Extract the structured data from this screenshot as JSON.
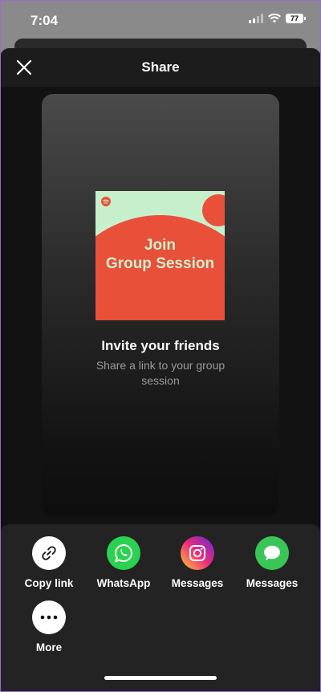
{
  "status_bar": {
    "time": "7:04",
    "battery": "77",
    "icons": [
      "cellular-signal-icon",
      "wifi-icon",
      "battery-icon"
    ]
  },
  "header": {
    "title": "Share",
    "close_icon": "close-icon"
  },
  "preview": {
    "cover_text_line1": "Join",
    "cover_text_line2": "Group Session",
    "title": "Invite your friends",
    "subtitle": "Share a link to your group session"
  },
  "share_targets": [
    {
      "label": "Copy link",
      "icon": "link-icon",
      "color": "#ffffff"
    },
    {
      "label": "WhatsApp",
      "icon": "whatsapp-icon",
      "color": "#2bd150"
    },
    {
      "label": "Messages",
      "icon": "instagram-icon",
      "color": "#d6249f"
    },
    {
      "label": "Messages",
      "icon": "messages-icon",
      "color": "#39c656"
    },
    {
      "label": "More",
      "icon": "more-icon",
      "color": "#ffffff"
    }
  ],
  "colors": {
    "sheet_background": "#121212",
    "tray_background": "#232323",
    "cover_green": "#c6f0cc",
    "cover_red": "#e8503a"
  }
}
